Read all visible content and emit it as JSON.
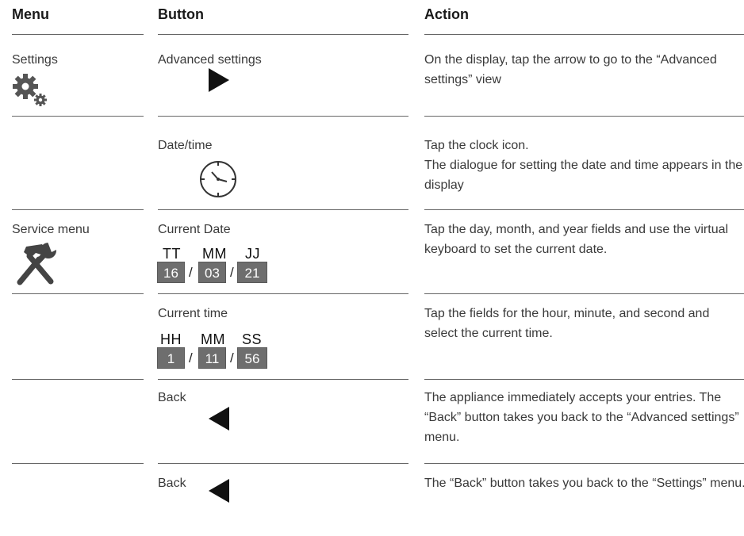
{
  "headers": {
    "menu": "Menu",
    "button": "Button",
    "action": "Action"
  },
  "rows": [
    {
      "menu": "Settings",
      "menu_icon": "gears-icon",
      "button": "Advanced settings",
      "button_icon": "arrow-right-icon",
      "action": "On the display, tap the arrow to go to the “Advanced settings” view"
    },
    {
      "menu": "",
      "button": "Date/time",
      "button_icon": "clock-icon",
      "action": "Tap the clock icon.\nThe dialogue for setting the date and time appears in the display"
    },
    {
      "menu": "Service menu",
      "menu_icon": "hammer-wrench-icon",
      "button": "Current Date",
      "fields": {
        "labels": [
          "TT",
          "MM",
          "JJ"
        ],
        "values": [
          "16",
          "03",
          "21"
        ],
        "separator": "/"
      },
      "action": "Tap the day, month, and year fields and use the virtual keyboard to set the current date."
    },
    {
      "menu": "",
      "button": "Current time",
      "fields": {
        "labels": [
          "HH",
          "MM",
          "SS"
        ],
        "values": [
          "1",
          "11",
          "56"
        ],
        "separator": "/"
      },
      "action": "Tap the fields for the hour, minute, and second and select the current time."
    },
    {
      "menu": "",
      "button": "Back",
      "button_icon": "arrow-left-icon",
      "action": "The appliance immediately accepts your entries. The “Back” button takes you back to the “Advanced settings” menu."
    },
    {
      "menu": "",
      "button": "Back",
      "button_icon": "arrow-left-icon",
      "action": "The “Back” button takes you back to the “Settings” menu."
    }
  ]
}
